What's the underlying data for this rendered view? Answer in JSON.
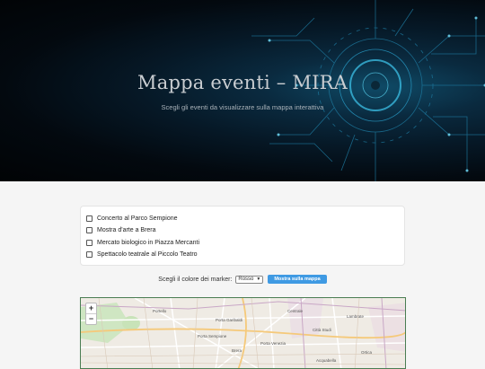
{
  "hero": {
    "title": "Mappa eventi – MIRA",
    "subtitle": "Scegli gli eventi da visualizzare sulla mappa interattiva"
  },
  "events": [
    {
      "label": "Concerto al Parco Sempione",
      "checked": false
    },
    {
      "label": "Mostra d'arte a Brera",
      "checked": false
    },
    {
      "label": "Mercato biologico in Piazza Mercanti",
      "checked": false
    },
    {
      "label": "Spettacolo teatrale al Piccolo Teatro",
      "checked": false
    }
  ],
  "controls": {
    "color_label": "Scegli il colore dei marker:",
    "color_selected": "Rosso",
    "show_button": "Mostra sulla mappa"
  },
  "map": {
    "zoom_in": "+",
    "zoom_out": "−",
    "labels": [
      "Portello",
      "Porta Garibaldi",
      "Centrale",
      "Lambrate",
      "Porta Sempione",
      "Città Studi",
      "Brera",
      "Porta Venezia",
      "Ortica",
      "Acquabella"
    ]
  },
  "colors": {
    "accent_button": "#3f9ae3",
    "map_border": "#4a7d52"
  }
}
